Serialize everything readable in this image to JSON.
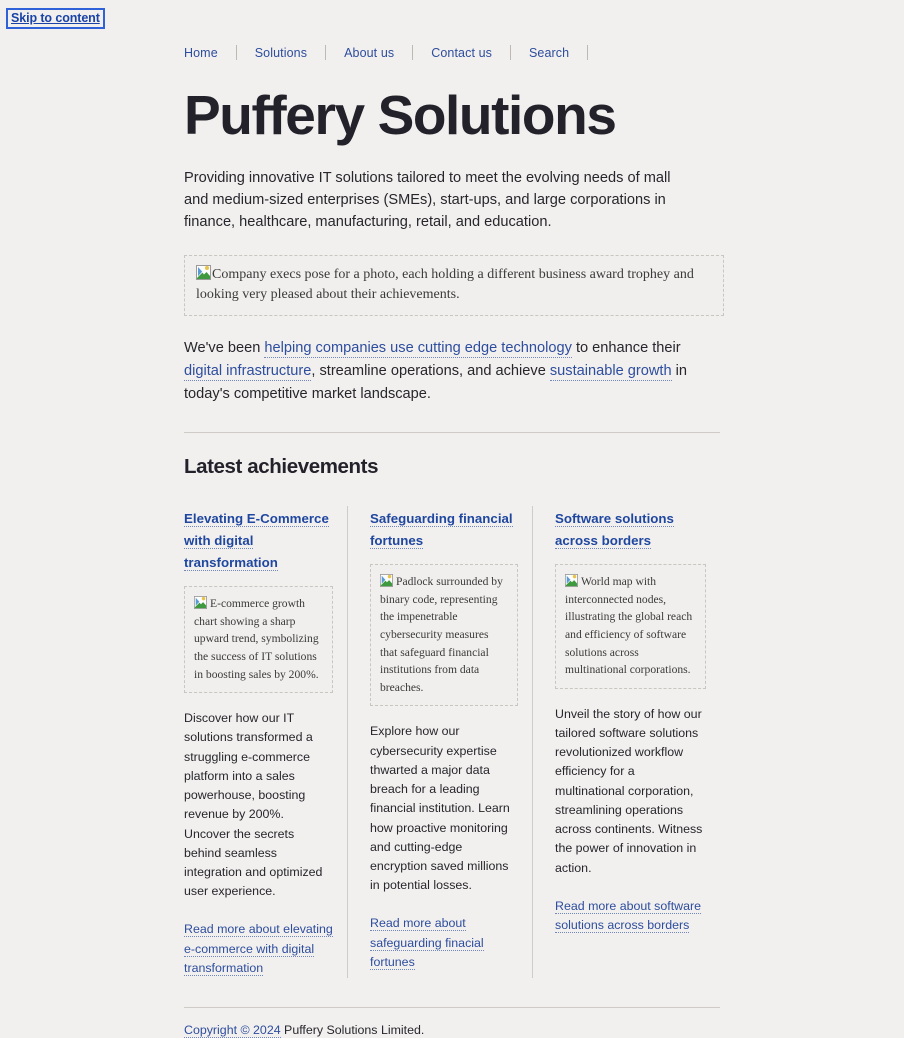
{
  "skip_link": {
    "label": "Skip to content"
  },
  "nav": {
    "items": [
      {
        "label": "Home"
      },
      {
        "label": "Solutions"
      },
      {
        "label": "About us"
      },
      {
        "label": "Contact us"
      },
      {
        "label": "Search"
      }
    ]
  },
  "hero": {
    "title": "Puffery Solutions",
    "intro": "Providing innovative IT solutions tailored to meet the evolving needs of mall and medium-sized enterprises (SMEs), start-ups, and large corporations in finance, healthcare, manufacturing, retail, and education.",
    "image_alt": "Company execs pose for a photo, each holding a different business award trophey and looking very pleased about their achievements.",
    "links_paragraph": {
      "t1": "We've been ",
      "a1": "helping companies use cutting edge technology",
      "t2": " to enhance their ",
      "a2": "digital infrastructure",
      "t3": ", streamline operations, and achieve ",
      "a3": "sustainable growth",
      "t4": " in today's competitive market landscape."
    }
  },
  "section": {
    "title": "Latest achievements",
    "cards": [
      {
        "title": "Elevating E-Commerce with digital transformation",
        "image_alt": "E-commerce growth chart showing a sharp upward trend, symbolizing the success of IT solutions in boosting sales by 200%.",
        "body": "Discover how our IT solutions transformed a struggling e-commerce platform into a sales powerhouse, boosting revenue by 200%. Uncover the secrets behind seamless integration and optimized user experience.",
        "more_label": "Read more about elevating e-commerce with digital transformation"
      },
      {
        "title": "Safeguarding financial fortunes",
        "image_alt": "Padlock surrounded by binary code, representing the impenetrable cybersecurity measures that safeguard financial institutions from data breaches.",
        "body": "Explore how our cybersecurity expertise thwarted a major data breach for a leading financial institution. Learn how proactive monitoring and cutting-edge encryption saved millions in potential losses.",
        "more_label": "Read more about safeguarding finacial fortunes"
      },
      {
        "title": "Software solutions across borders",
        "image_alt": "World map with interconnected nodes, illustrating the global reach and efficiency of software solutions across multinational corporations.",
        "body": "Unveil the story of how our tailored software solutions revolutionized workflow efficiency for a multinational corporation, streamlining operations across continents. Witness the power of innovation in action.",
        "more_label": "Read more about software solutions across borders"
      }
    ]
  },
  "footer": {
    "copyright_link": "Copyright © 2024",
    "copyright_rest": " Puffery Solutions Limited."
  },
  "colors": {
    "background": "#f2f0ee",
    "heading": "#23222b",
    "link": "#2d4d9e",
    "card_title_link": "#1f47a0",
    "focus_ring": "#2f62d8",
    "divider": "#cfcbc6"
  }
}
